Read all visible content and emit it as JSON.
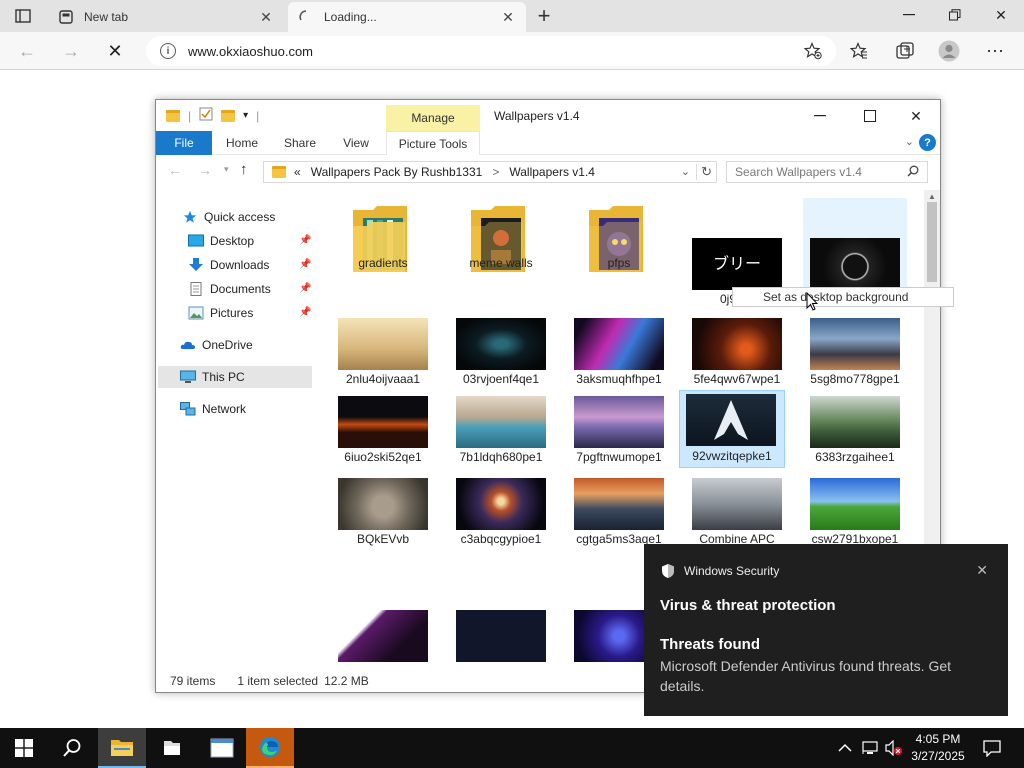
{
  "browser": {
    "tabs": [
      {
        "title": "New tab"
      },
      {
        "title": "Loading..."
      }
    ],
    "url": "www.okxiaoshuo.com"
  },
  "explorer": {
    "window_title": "Wallpapers v1.4",
    "manage_label": "Manage",
    "ribbon_tabs": [
      "File",
      "Home",
      "Share",
      "View",
      "Picture Tools"
    ],
    "breadcrumb_prefix": "«",
    "breadcrumb": [
      "Wallpapers Pack By Rushb1331",
      "Wallpapers v1.4"
    ],
    "breadcrumb_sep": ">",
    "search_placeholder": "Search Wallpapers v1.4",
    "nav": {
      "quick_access": "Quick access",
      "desktop": "Desktop",
      "downloads": "Downloads",
      "documents": "Documents",
      "pictures": "Pictures",
      "onedrive": "OneDrive",
      "this_pc": "This PC",
      "network": "Network"
    },
    "items": [
      "gradients",
      "meme walls",
      "pfps",
      "0j9rfor",
      "",
      "2nlu4oijvaaa1",
      "03rvjoenf4qe1",
      "3aksmuqhfhpe1",
      "5fe4qwv67wpe1",
      "5sg8mo778gpe1",
      "6iuo2ski52qe1",
      "7b1ldqh680pe1",
      "7pgftnwumope1",
      "92vwzitqepke1",
      "6383rzgaihee1",
      "BQkEVvb",
      "c3abqcgypioe1",
      "cgtga5ms3aqe1",
      "Combine APC",
      "csw2791bxope1",
      "",
      "",
      ""
    ],
    "tooltip": "Set as desktop background",
    "status": {
      "count": "79 items",
      "selected": "1 item selected",
      "size": "12.2 MB"
    }
  },
  "toast": {
    "app": "Windows Security",
    "heading": "Virus & threat protection",
    "subheading": "Threats found",
    "body": "Microsoft Defender Antivirus found threats. Get details."
  },
  "taskbar": {
    "time": "4:05 PM",
    "date": "3/27/2025"
  },
  "colors": {
    "accent": "#1979ca",
    "selection": "#cce8ff",
    "manage": "#f8f1a6",
    "toast_bg": "#1f1f1f",
    "taskbar_bg": "#101010"
  }
}
